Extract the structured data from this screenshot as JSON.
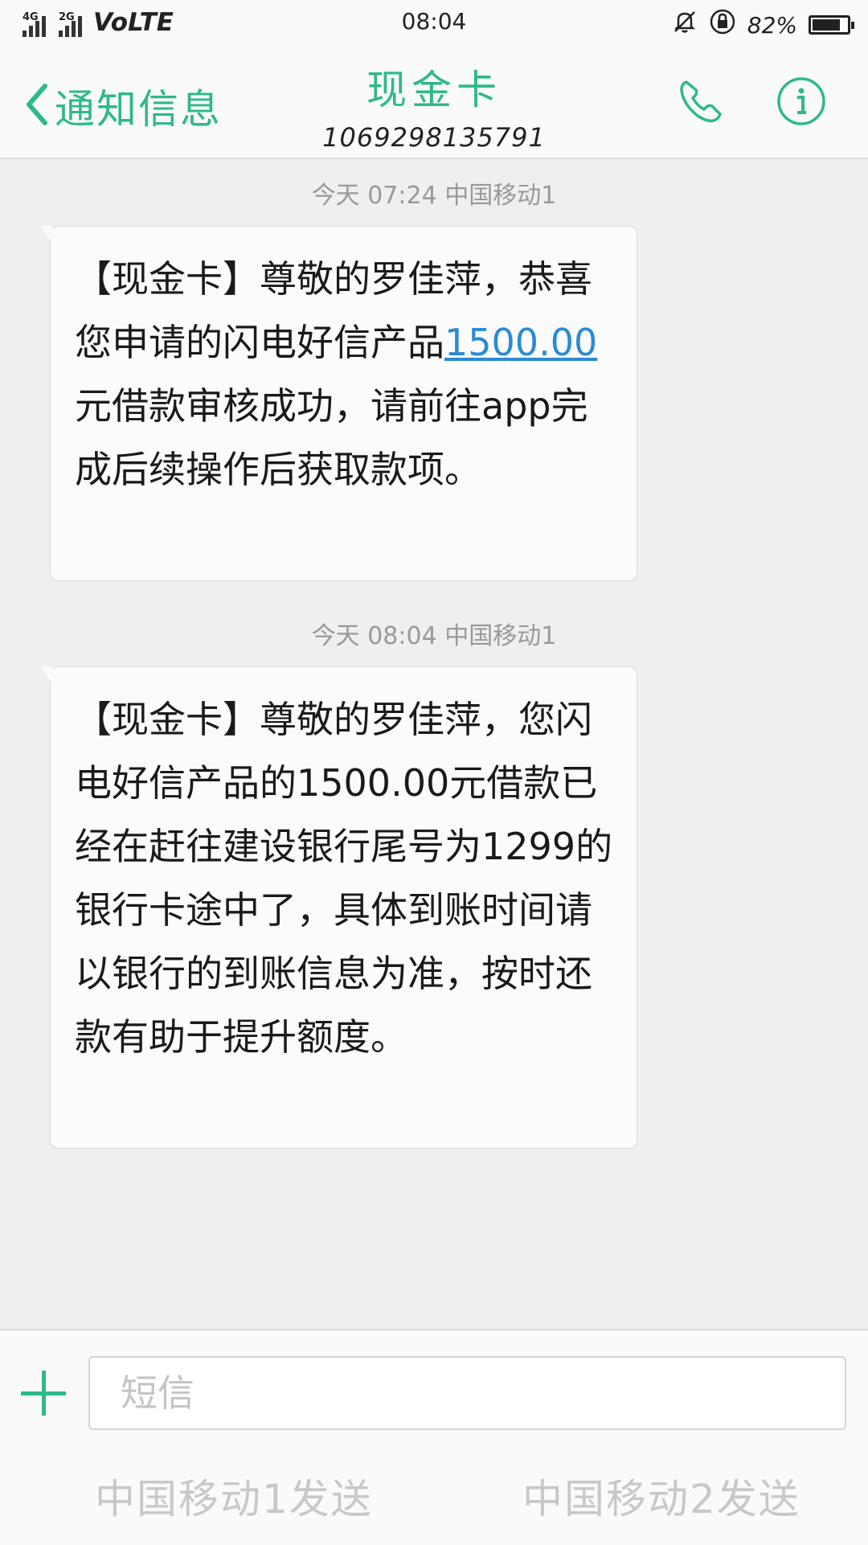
{
  "status_bar": {
    "sim1_label": "4G",
    "sim2_label": "2G",
    "network": "VoLTE",
    "time": "08:04",
    "battery_percent": "82%",
    "battery_level": 0.82
  },
  "header": {
    "back_label": "通知信息",
    "contact_name": "现金卡",
    "contact_number": "1069298135791"
  },
  "messages": [
    {
      "timestamp": "今天 07:24  中国移动1",
      "text_before": "【现金卡】尊敬的罗佳萍，恭喜您申请的闪电好信产品",
      "amount_link": "1500.00",
      "text_after": "元借款审核成功，请前往app完成后续操作后获取款项。"
    },
    {
      "timestamp": "今天 08:04  中国移动1",
      "text": "【现金卡】尊敬的罗佳萍，您闪电好信产品的1500.00元借款已经在赶往建设银行尾号为1299的银行卡途中了，具体到账时间请以银行的到账信息为准，按时还款有助于提升额度。"
    }
  ],
  "composer": {
    "placeholder": "短信",
    "send_sim1": "中国移动1发送",
    "send_sim2": "中国移动2发送"
  },
  "colors": {
    "accent": "#2fb98a",
    "link": "#2a8bd6"
  },
  "icons": {
    "back": "chevron-left-icon",
    "call": "phone-icon",
    "info": "info-icon",
    "add": "plus-icon",
    "mute": "bell-off-icon",
    "rotation_lock": "rotation-lock-icon"
  }
}
